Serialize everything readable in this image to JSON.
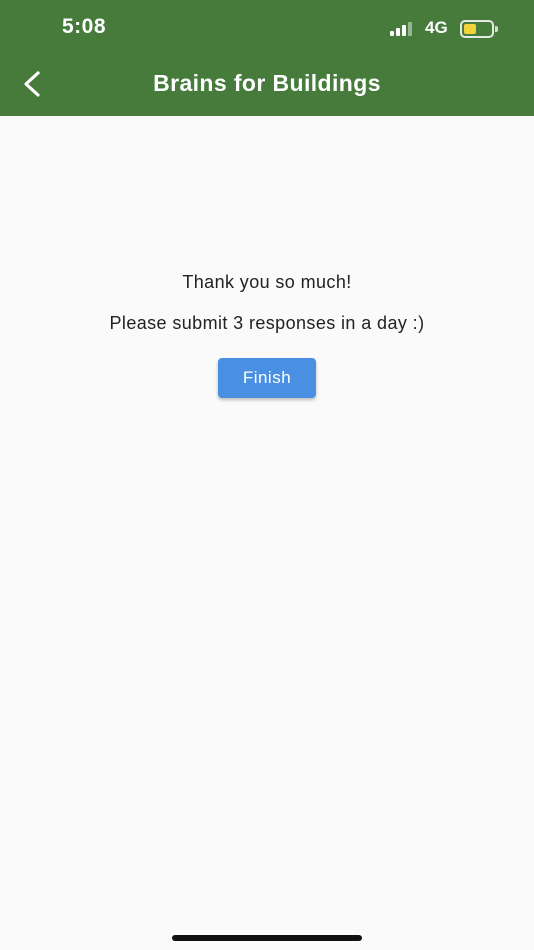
{
  "status_bar": {
    "time": "5:08",
    "network": "4G",
    "signal_bars_active": 3,
    "signal_bars_total": 4,
    "battery_level_fraction": 0.45,
    "battery_color": "#f2d33a"
  },
  "app_bar": {
    "title": "Brains for Buildings",
    "back_icon": "chevron-left-icon",
    "background": "#467b3c"
  },
  "main": {
    "thank_you": "Thank you so much!",
    "instruction": "Please submit 3 responses in a day :)",
    "finish_label": "Finish",
    "finish_color": "#4a90e2"
  }
}
